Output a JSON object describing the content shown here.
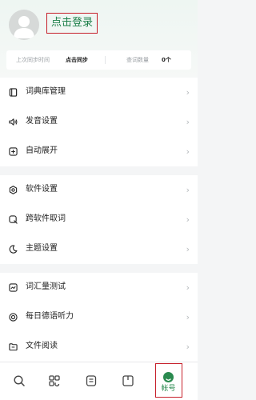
{
  "header": {
    "login_label": "点击登录"
  },
  "sync": {
    "last_sync_label": "上次同步时间",
    "sync_action": "点击同步",
    "query_count_label": "查词数量",
    "query_count_value": "0个"
  },
  "menu": {
    "group1": [
      {
        "label": "词典库管理",
        "icon": "book-icon"
      },
      {
        "label": "发音设置",
        "icon": "speaker-icon"
      },
      {
        "label": "自动展开",
        "icon": "expand-icon"
      }
    ],
    "group2": [
      {
        "label": "软件设置",
        "icon": "settings-icon"
      },
      {
        "label": "跨软件取词",
        "icon": "magnifier-icon"
      },
      {
        "label": "主题设置",
        "icon": "moon-icon"
      }
    ],
    "group3": [
      {
        "label": "词汇量测试",
        "icon": "chart-icon"
      },
      {
        "label": "每日德语听力",
        "icon": "headphones-icon"
      },
      {
        "label": "文件阅读",
        "icon": "folder-icon"
      }
    ],
    "chevron": "›"
  },
  "tabbar": {
    "tabs": [
      {
        "icon": "search-icon"
      },
      {
        "icon": "scan-icon"
      },
      {
        "icon": "notebook-icon"
      },
      {
        "icon": "flashcard-icon"
      },
      {
        "icon": "account-icon",
        "label": "帐号"
      }
    ]
  },
  "colors": {
    "accent": "#2a8a4f",
    "highlight_border": "#c61f2a",
    "background": "#f4f5f6"
  }
}
